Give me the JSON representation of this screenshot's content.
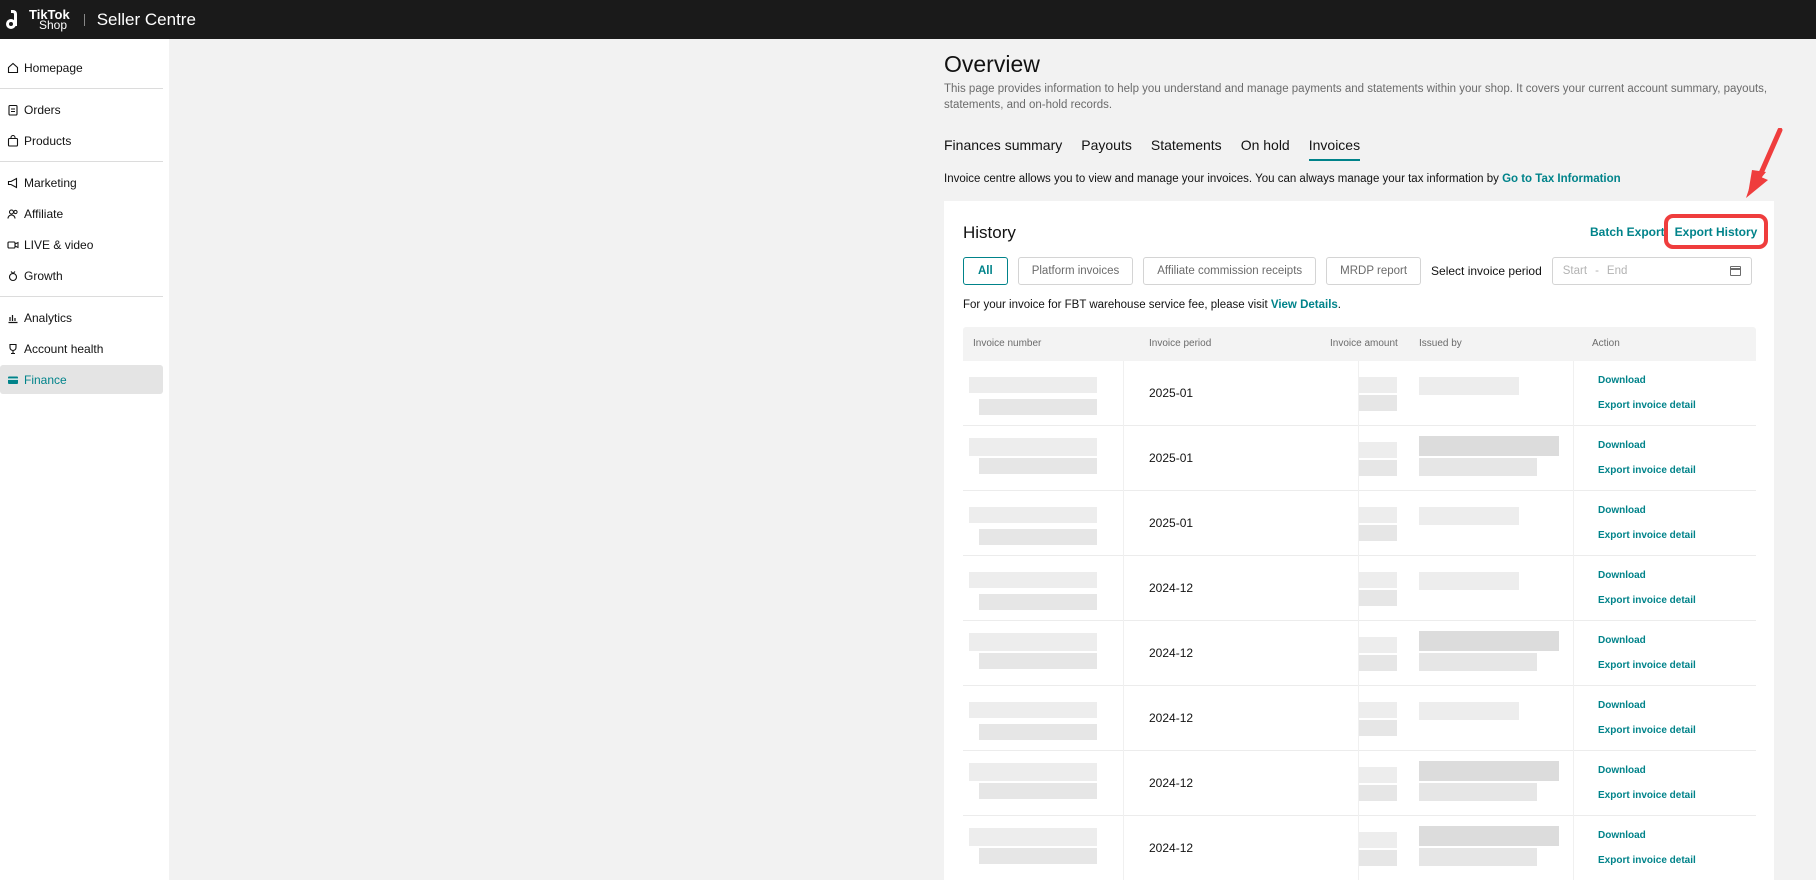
{
  "brand": {
    "logo_line1": "TikTok",
    "logo_line2": "Shop",
    "app_title": "Seller Centre"
  },
  "sidebar": {
    "items": [
      {
        "label": "Homepage",
        "icon": "home-icon"
      },
      {
        "label": "Orders",
        "icon": "clipboard-icon"
      },
      {
        "label": "Products",
        "icon": "bag-icon"
      },
      {
        "label": "Marketing",
        "icon": "megaphone-icon"
      },
      {
        "label": "Affiliate",
        "icon": "people-icon"
      },
      {
        "label": "LIVE & video",
        "icon": "video-icon"
      },
      {
        "label": "Growth",
        "icon": "medal-icon"
      },
      {
        "label": "Analytics",
        "icon": "chart-icon"
      },
      {
        "label": "Account health",
        "icon": "trophy-icon"
      },
      {
        "label": "Finance",
        "icon": "card-icon"
      }
    ],
    "active": "Finance"
  },
  "page": {
    "title": "Overview",
    "description": "This page provides information to help you understand and manage payments and statements within your shop. It covers your current account summary, payouts, statements, and on-hold records."
  },
  "tabs": [
    "Finances summary",
    "Payouts",
    "Statements",
    "On hold",
    "Invoices"
  ],
  "active_tab": "Invoices",
  "info": {
    "text": "Invoice centre allows you to view and manage your invoices. You can always manage your tax information by ",
    "link": "Go to Tax Information"
  },
  "history": {
    "title": "History",
    "batch_export": "Batch Export",
    "export_history": "Export History",
    "filters": [
      "All",
      "Platform invoices",
      "Affiliate commission receipts",
      "MRDP report"
    ],
    "active_filter": "All",
    "period_label": "Select invoice period",
    "range_start_placeholder": "Start",
    "range_sep": "-",
    "range_end_placeholder": "End",
    "fbt_text": "For your invoice for FBT warehouse service fee, please visit ",
    "fbt_link": "View Details",
    "fbt_end": ".",
    "columns": [
      "Invoice number",
      "Invoice period",
      "Invoice amount",
      "Issued by",
      "Action"
    ],
    "rows": [
      {
        "period": "2025-01",
        "download": "Download",
        "export": "Export invoice detail"
      },
      {
        "period": "2025-01",
        "download": "Download",
        "export": "Export invoice detail"
      },
      {
        "period": "2025-01",
        "download": "Download",
        "export": "Export invoice detail"
      },
      {
        "period": "2024-12",
        "download": "Download",
        "export": "Export invoice detail"
      },
      {
        "period": "2024-12",
        "download": "Download",
        "export": "Export invoice detail"
      },
      {
        "period": "2024-12",
        "download": "Download",
        "export": "Export invoice detail"
      },
      {
        "period": "2024-12",
        "download": "Download",
        "export": "Export invoice detail"
      },
      {
        "period": "2024-12",
        "download": "Download",
        "export": "Export invoice detail"
      }
    ]
  },
  "colors": {
    "accent": "#00838a",
    "highlight": "#ef3d3d",
    "topbar": "#1a1a1a"
  }
}
